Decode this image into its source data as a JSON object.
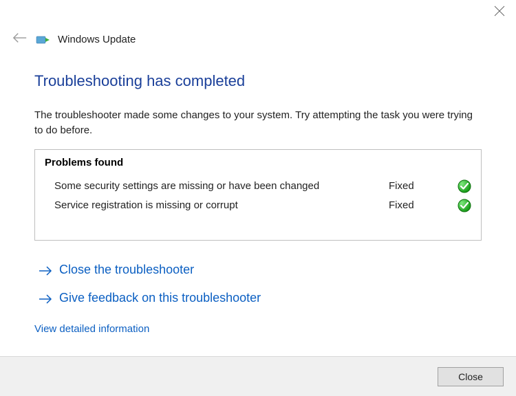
{
  "titlebar": {
    "close_tooltip": "Close"
  },
  "header": {
    "back_tooltip": "Back",
    "app_title": "Windows Update"
  },
  "main": {
    "heading": "Troubleshooting has completed",
    "description": "The troubleshooter made some changes to your system. Try attempting the task you were trying to do before.",
    "problems_title": "Problems found",
    "problems": [
      {
        "description": "Some security settings are missing or have been changed",
        "status": "Fixed",
        "icon": "check-ok"
      },
      {
        "description": "Service registration is missing or corrupt",
        "status": "Fixed",
        "icon": "check-ok"
      }
    ],
    "actions": {
      "close_troubleshooter": "Close the troubleshooter",
      "give_feedback": "Give feedback on this troubleshooter"
    },
    "detail_link": "View detailed information"
  },
  "footer": {
    "close_button": "Close"
  }
}
